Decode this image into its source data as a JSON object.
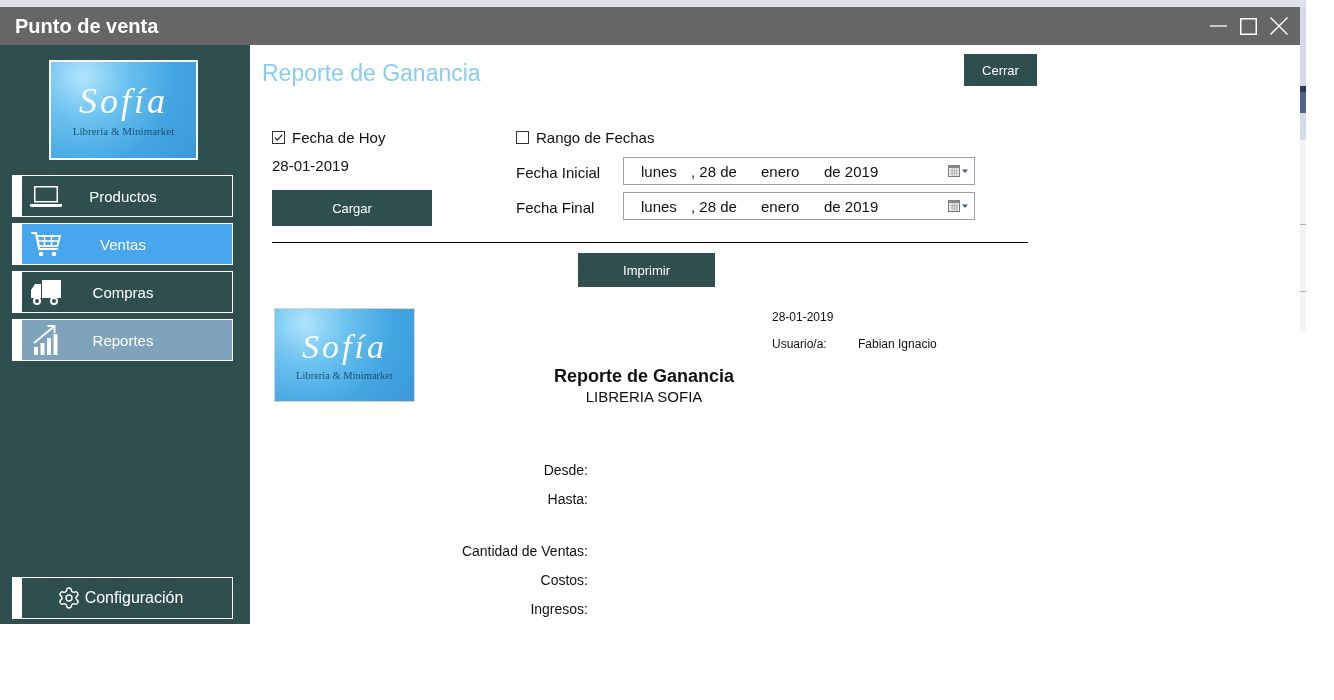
{
  "window": {
    "title": "Punto de venta"
  },
  "sidebar": {
    "logo": {
      "wordmark": "Sofía",
      "tagline": "Librería & Minimarket"
    },
    "items": [
      {
        "label": "Productos",
        "selected": false,
        "hovered": false
      },
      {
        "label": "Ventas",
        "selected": false,
        "hovered": true
      },
      {
        "label": "Compras",
        "selected": false,
        "hovered": false
      },
      {
        "label": "Reportes",
        "selected": true,
        "hovered": false
      }
    ],
    "settings_button": "Configuración"
  },
  "header": {
    "title": "Reporte de Ganancia",
    "close_button": "Cerrar"
  },
  "filters": {
    "today": {
      "label": "Fecha de Hoy",
      "checked": true,
      "date": "28-01-2019",
      "load_button": "Cargar"
    },
    "range": {
      "label": "Rango de Fechas",
      "checked": false,
      "fields": [
        {
          "label": "Fecha Inicial",
          "value": [
            "lunes",
            ", 28 de",
            "enero",
            "de 2019"
          ]
        },
        {
          "label": "Fecha Final",
          "value": [
            "lunes",
            ", 28 de",
            "enero",
            "de 2019"
          ]
        }
      ]
    }
  },
  "print_button": "Imprimir",
  "report": {
    "logo": {
      "wordmark": "Sofía",
      "tagline": "Librería & Minimarket"
    },
    "date": "28-01-2019",
    "user_label": "Usuario/a:",
    "user": "Fabian Ignacio",
    "title": "Reporte de Ganancia",
    "subtitle": "LIBRERIA SOFIA",
    "period_labels": [
      "Desde:",
      "Hasta:"
    ],
    "total_labels": [
      "Cantidad de Ventas:",
      "Costos:",
      "Ingresos:"
    ]
  }
}
